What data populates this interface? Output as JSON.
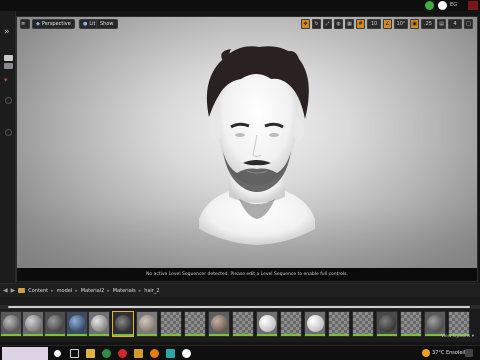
{
  "topbar": {
    "right_text": "EG",
    "colors": {
      "badge": "#3cae3c",
      "close": "#7a1818"
    }
  },
  "viewport": {
    "toolbar": {
      "menu_icon": "hamburger-icon",
      "perspective_label": "Perspective",
      "lit_label": "Lit",
      "show_label": "Show"
    },
    "status_message": "No active Level Sequencer detected. Please edit a Level Sequence to enable full controls."
  },
  "content_browser": {
    "breadcrumb": [
      "Content",
      "model",
      "Material2",
      "Materials",
      "hair_2"
    ],
    "footer_label": "View Options ▾",
    "thumbnails_count": 20
  },
  "taskbar": {
    "weather": "37°C  Ensoleillé",
    "app_icons": [
      "search-icon",
      "task-view-icon",
      "file-explorer-icon",
      "chrome-icon",
      "opera-icon",
      "folder-icon",
      "blender-icon",
      "maya-icon",
      "unreal-icon"
    ]
  }
}
